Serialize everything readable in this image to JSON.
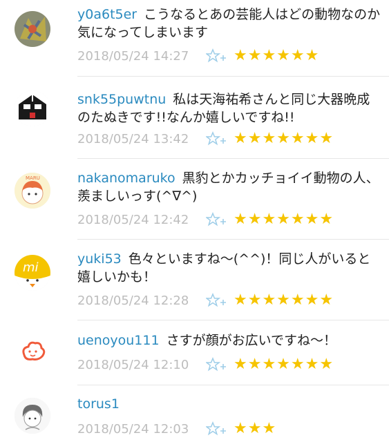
{
  "comments": [
    {
      "username": "y0a6t5er",
      "text": "こうなるとあの芸能人はどの動物なのか気になってしまいます",
      "date": "2018/05/24 14:27",
      "stars": "★★★★★★"
    },
    {
      "username": "snk55puwtnu",
      "text": "私は天海祐希さんと同じ大器晩成のたぬきです!!なんか嬉しいですね!!",
      "date": "2018/05/24 13:42",
      "stars": "★★★★★★★"
    },
    {
      "username": "nakanomaruko",
      "text": "黒豹とかカッチョイイ動物の人、羨ましいっす(^∇^)",
      "date": "2018/05/24 12:42",
      "stars": "★★★★★★★"
    },
    {
      "username": "yuki53",
      "text": "色々といますね〜(^^)！同じ人がいると嬉しいかも！",
      "date": "2018/05/24 12:28",
      "stars": "★★★★★★★"
    },
    {
      "username": "uenoyou111",
      "text": "さすが顔がお広いですね〜！",
      "date": "2018/05/24 12:10",
      "stars": "★★★★★★★"
    },
    {
      "username": "torus1",
      "text": "",
      "date": "2018/05/24 12:03",
      "stars": "★★★"
    }
  ],
  "colors": {
    "username": "#2a8abf",
    "star": "#f6c400",
    "date": "#bdbdbd",
    "star_add_icon": "#9ecde8"
  },
  "icons": {
    "star_add": "star-add-icon"
  }
}
